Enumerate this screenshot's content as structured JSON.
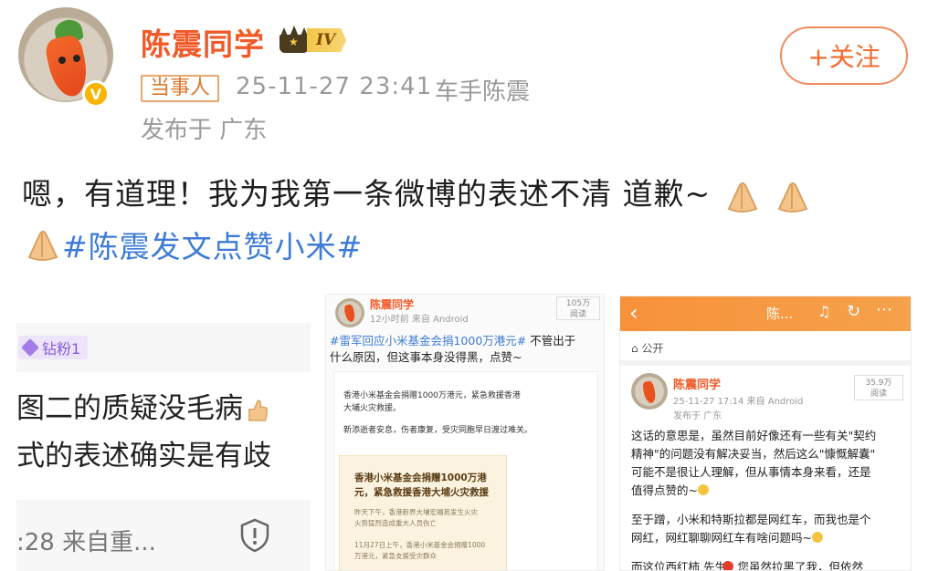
{
  "header": {
    "username": "陈震同学",
    "level_badge": "IV",
    "role_tag": "当事人",
    "timestamp": "25-11-27 23:41",
    "source": "车手陈震",
    "location": "发布于 广东",
    "follow_label": "+关注",
    "verified_mark": "V"
  },
  "post": {
    "line1": "嗯，有道理！我为我第一条微博的表述不清 道歉~",
    "hashtag": "#陈震发文点赞小米#"
  },
  "images": {
    "panel1": {
      "fan_tag": "钻粉1",
      "line1": "图二的质疑没毛病",
      "line2": "式的表述确实是有歧",
      "footer": ":28 来自重..."
    },
    "panel2": {
      "name": "陈震同学",
      "meta": "12小时前  来自 Android",
      "count": "105万",
      "count_label": "阅读",
      "text1": "#雷军回应小米基金会捐1000万港元#",
      "text1_rest": " 不管出于",
      "text2": "什么原因，但这事本身没得黑，点赞~",
      "inner_line1": "香港小米基金会捐赠1000万港元，紧急救援香港",
      "inner_line2": "大埔火灾救援。",
      "inner_line3": "新添逝者安息，伤者康复，受灾同胞早日渡过难关。",
      "card_title1": "香港小米基金会捐赠1000万港",
      "card_title2": "元，紧急救援香港大埔火灾救援",
      "card_small1": "昨天下午，香港新界大埔宏福苑发生火灾",
      "card_small2": "火势猛烈造成重大人员伤亡",
      "card_small3": "11月27日上午，香港小米基金会捐赠1000",
      "card_small4": "万港元，紧急支援受灾群众"
    },
    "panel3": {
      "bar_title": "陈...",
      "public": "公开",
      "name": "陈震同学",
      "meta": "25-11-27 17:14  来自 Android",
      "location": "发布于 广东",
      "count": "35.9万",
      "count_label": "阅读",
      "lines": [
        "这话的意思是，虽然目前好像还有一些有关\"契约",
        "精神\"的问题没有解决妥当，然后这么\"慷慨解囊\"",
        "可能不是很让人理解，但从事情本身来看，还是",
        "值得点赞的~",
        "",
        "至于蹭，小米和特斯拉都是网红车，而我也是个",
        "网红，网红聊聊网红车有啥问题吗~",
        "",
        "而这位西红柿  先生，您虽然拉黑了我，但依然"
      ]
    }
  },
  "colors": {
    "orange": "#f05a28",
    "link_blue": "#3d7bd6",
    "gray_text": "#9a9a9a"
  }
}
